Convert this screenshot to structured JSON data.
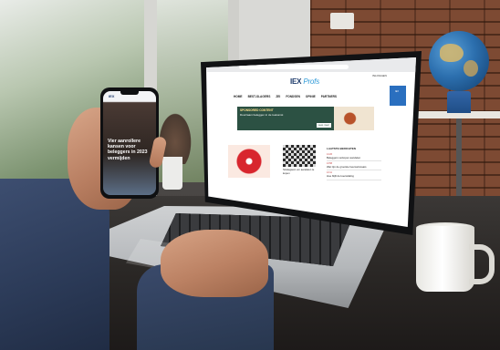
{
  "scene": {
    "laptop_site": {
      "logo_main": "IEX",
      "logo_accent": "Profs",
      "login": "INLOGGEN",
      "nav": [
        "HOME",
        "BEST-SLAGERS",
        "ZEI",
        "FONDSEN",
        "OPINIE",
        "PARTNERS"
      ],
      "hero_tag": "SPONSORED CONTENT",
      "hero_text": "Duurzaam beleggen in de toekomst",
      "hero_button": "Lees meer",
      "badge_text": "IEX",
      "article_caption": "Strategieën om aandelen te kopen",
      "sidebar_title": "LAATSTE BERICHTEN",
      "sidebar_items": [
        {
          "time": "14:26",
          "text": "Beleggers verkopen aandelen"
        },
        {
          "time": "13:58",
          "text": "Wat zijn de grootste beurswinnaars"
        },
        {
          "time": "13:11",
          "text": "Hoe blijft de koersdaling"
        }
      ]
    },
    "phone_site": {
      "logo": "IEX",
      "headline": "Vier aanrollere kansen voor beleggers in 2023 vermijden"
    }
  }
}
